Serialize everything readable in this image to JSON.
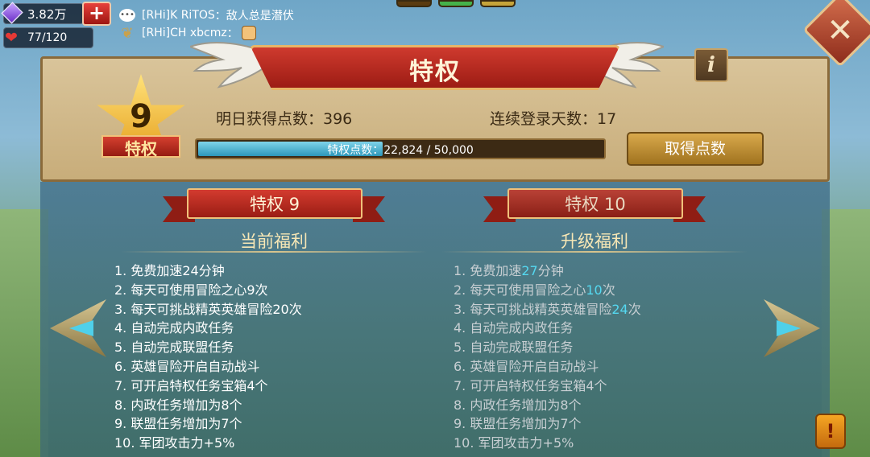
{
  "resources": {
    "gems": "3.82万",
    "stamina": "77/120",
    "plus_label": "+"
  },
  "chat": [
    {
      "user": "[RHi]K RiTOS",
      "message": "：敌人总是潜伏"
    },
    {
      "user": "[RHi]CH xbcmz",
      "message": "："
    }
  ],
  "header": {
    "title": "特权",
    "info_label": "i",
    "close_label": "✕"
  },
  "vip": {
    "level": "9",
    "badge_label": "特权",
    "tomorrow_points": "明日获得点数：396",
    "login_days": "连续登录天数：17",
    "points_label": "特权点数：22,824 / 50,000",
    "progress": 0.456,
    "get_points_button": "取得点数"
  },
  "current": {
    "ribbon": "特权 9",
    "title": "当前福利",
    "items": [
      "1. 免费加速24分钟",
      "2. 每天可使用冒险之心9次",
      "3. 每天可挑战精英英雄冒险20次",
      "4. 自动完成内政任务",
      "5. 自动完成联盟任务",
      "6. 英雄冒险开启自动战斗",
      "7. 可开启特权任务宝箱4个",
      "8. 内政任务增加为8个",
      "9. 联盟任务增加为7个",
      "10. 军团攻击力+5%"
    ]
  },
  "next": {
    "ribbon": "特权 10",
    "title": "升级福利",
    "items": [
      {
        "pre": "1. 免费加速",
        "hl": "27",
        "post": "分钟"
      },
      {
        "pre": "2. 每天可使用冒险之心",
        "hl": "10",
        "post": "次"
      },
      {
        "pre": "3. 每天可挑战精英英雄冒险",
        "hl": "24",
        "post": "次"
      },
      {
        "pre": "4. 自动完成内政任务",
        "hl": "",
        "post": ""
      },
      {
        "pre": "5. 自动完成联盟任务",
        "hl": "",
        "post": ""
      },
      {
        "pre": "6. 英雄冒险开启自动战斗",
        "hl": "",
        "post": ""
      },
      {
        "pre": "7. 可开启特权任务宝箱4个",
        "hl": "",
        "post": ""
      },
      {
        "pre": "8. 内政任务增加为8个",
        "hl": "",
        "post": ""
      },
      {
        "pre": "9. 联盟任务增加为7个",
        "hl": "",
        "post": ""
      },
      {
        "pre": "10. 军团攻击力+5%",
        "hl": "",
        "post": ""
      }
    ]
  },
  "alert_label": "!"
}
